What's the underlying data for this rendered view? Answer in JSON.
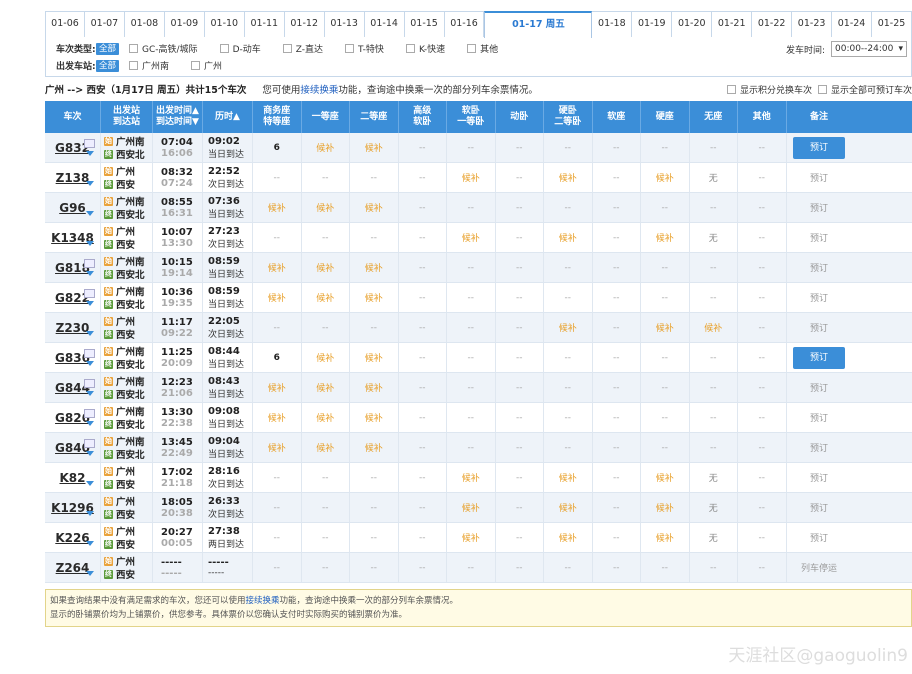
{
  "dates": [
    "01-06",
    "01-07",
    "01-08",
    "01-09",
    "01-10",
    "01-11",
    "01-12",
    "01-13",
    "01-14",
    "01-15",
    "01-16",
    "01-17 周五",
    "01-18",
    "01-19",
    "01-20",
    "01-21",
    "01-22",
    "01-23",
    "01-24",
    "01-25"
  ],
  "active_date_index": 11,
  "filters": {
    "type_label": "车次类型:",
    "all_label": "全部",
    "types": [
      "GC-高铁/城际",
      "D-动车",
      "Z-直达",
      "T-特快",
      "K-快速",
      "其他"
    ],
    "station_label": "出发车站:",
    "stations": [
      "广州南",
      "广州"
    ],
    "dep_time_label": "发车时间:",
    "dep_time_value": "00:00--24:00"
  },
  "summary": {
    "route": "广州 --> 西安（1月17日  周五）共计15个车次",
    "hint_pre": "您可使用",
    "hint_link": "接续换乘",
    "hint_post": "功能，查询途中换乘一次的部分列车余票情况。",
    "opt1": "显示积分兑换车次",
    "opt2": "显示全部可预订车次"
  },
  "headers": {
    "train": "车次",
    "station": [
      "出发站",
      "到达站"
    ],
    "time": [
      "出发时间▲",
      "到达时间▼"
    ],
    "duration": "历时▲",
    "seats": [
      "商务座\n特等座",
      "一等座",
      "二等座",
      "高级\n软卧",
      "软卧\n一等卧",
      "动卧",
      "硬卧\n二等卧",
      "软座",
      "硬座",
      "无座",
      "其他"
    ],
    "remark": "备注"
  },
  "rows": [
    {
      "no": "G832",
      "from": "广州南",
      "to": "西安北",
      "dep": "07:04",
      "arr": "16:06",
      "dur": "09:02",
      "day": "当日到达",
      "seats": [
        "6",
        "候补",
        "候补",
        "--",
        "--",
        "--",
        "--",
        "--",
        "--",
        "--",
        "--"
      ],
      "book": "预订",
      "book_active": true,
      "icon": true
    },
    {
      "no": "Z138",
      "from": "广州",
      "to": "西安",
      "dep": "08:32",
      "arr": "07:24",
      "dur": "22:52",
      "day": "次日到达",
      "seats": [
        "--",
        "--",
        "--",
        "--",
        "候补",
        "--",
        "候补",
        "--",
        "候补",
        "无",
        "--"
      ],
      "book": "预订",
      "book_active": false,
      "icon": false
    },
    {
      "no": "G96",
      "from": "广州南",
      "to": "西安北",
      "dep": "08:55",
      "arr": "16:31",
      "dur": "07:36",
      "day": "当日到达",
      "seats": [
        "候补",
        "候补",
        "候补",
        "--",
        "--",
        "--",
        "--",
        "--",
        "--",
        "--",
        "--"
      ],
      "book": "预订",
      "book_active": false,
      "icon": false
    },
    {
      "no": "K1348",
      "from": "广州",
      "to": "西安",
      "dep": "10:07",
      "arr": "13:30",
      "dur": "27:23",
      "day": "次日到达",
      "seats": [
        "--",
        "--",
        "--",
        "--",
        "候补",
        "--",
        "候补",
        "--",
        "候补",
        "无",
        "--"
      ],
      "book": "预订",
      "book_active": false,
      "icon": false
    },
    {
      "no": "G818",
      "from": "广州南",
      "to": "西安北",
      "dep": "10:15",
      "arr": "19:14",
      "dur": "08:59",
      "day": "当日到达",
      "seats": [
        "候补",
        "候补",
        "候补",
        "--",
        "--",
        "--",
        "--",
        "--",
        "--",
        "--",
        "--"
      ],
      "book": "预订",
      "book_active": false,
      "icon": true
    },
    {
      "no": "G822",
      "from": "广州南",
      "to": "西安北",
      "dep": "10:36",
      "arr": "19:35",
      "dur": "08:59",
      "day": "当日到达",
      "seats": [
        "候补",
        "候补",
        "候补",
        "--",
        "--",
        "--",
        "--",
        "--",
        "--",
        "--",
        "--"
      ],
      "book": "预订",
      "book_active": false,
      "icon": true
    },
    {
      "no": "Z230",
      "from": "广州",
      "to": "西安",
      "dep": "11:17",
      "arr": "09:22",
      "dur": "22:05",
      "day": "次日到达",
      "seats": [
        "--",
        "--",
        "--",
        "--",
        "--",
        "--",
        "候补",
        "--",
        "候补",
        "候补",
        "--"
      ],
      "book": "预订",
      "book_active": false,
      "icon": false
    },
    {
      "no": "G836",
      "from": "广州南",
      "to": "西安北",
      "dep": "11:25",
      "arr": "20:09",
      "dur": "08:44",
      "day": "当日到达",
      "seats": [
        "6",
        "候补",
        "候补",
        "--",
        "--",
        "--",
        "--",
        "--",
        "--",
        "--",
        "--"
      ],
      "book": "预订",
      "book_active": true,
      "icon": true
    },
    {
      "no": "G844",
      "from": "广州南",
      "to": "西安北",
      "dep": "12:23",
      "arr": "21:06",
      "dur": "08:43",
      "day": "当日到达",
      "seats": [
        "候补",
        "候补",
        "候补",
        "--",
        "--",
        "--",
        "--",
        "--",
        "--",
        "--",
        "--"
      ],
      "book": "预订",
      "book_active": false,
      "icon": true
    },
    {
      "no": "G826",
      "from": "广州南",
      "to": "西安北",
      "dep": "13:30",
      "arr": "22:38",
      "dur": "09:08",
      "day": "当日到达",
      "seats": [
        "候补",
        "候补",
        "候补",
        "--",
        "--",
        "--",
        "--",
        "--",
        "--",
        "--",
        "--"
      ],
      "book": "预订",
      "book_active": false,
      "icon": true
    },
    {
      "no": "G840",
      "from": "广州南",
      "to": "西安北",
      "dep": "13:45",
      "arr": "22:49",
      "dur": "09:04",
      "day": "当日到达",
      "seats": [
        "候补",
        "候补",
        "候补",
        "--",
        "--",
        "--",
        "--",
        "--",
        "--",
        "--",
        "--"
      ],
      "book": "预订",
      "book_active": false,
      "icon": true
    },
    {
      "no": "K82",
      "from": "广州",
      "to": "西安",
      "dep": "17:02",
      "arr": "21:18",
      "dur": "28:16",
      "day": "次日到达",
      "seats": [
        "--",
        "--",
        "--",
        "--",
        "候补",
        "--",
        "候补",
        "--",
        "候补",
        "无",
        "--"
      ],
      "book": "预订",
      "book_active": false,
      "icon": false
    },
    {
      "no": "K1296",
      "from": "广州",
      "to": "西安",
      "dep": "18:05",
      "arr": "20:38",
      "dur": "26:33",
      "day": "次日到达",
      "seats": [
        "--",
        "--",
        "--",
        "--",
        "候补",
        "--",
        "候补",
        "--",
        "候补",
        "无",
        "--"
      ],
      "book": "预订",
      "book_active": false,
      "icon": false
    },
    {
      "no": "K226",
      "from": "广州",
      "to": "西安",
      "dep": "20:27",
      "arr": "00:05",
      "dur": "27:38",
      "day": "两日到达",
      "seats": [
        "--",
        "--",
        "--",
        "--",
        "候补",
        "--",
        "候补",
        "--",
        "候补",
        "无",
        "--"
      ],
      "book": "预订",
      "book_active": false,
      "icon": false
    },
    {
      "no": "Z264",
      "from": "广州",
      "to": "西安",
      "dep": "-----",
      "arr": "-----",
      "dur": "-----",
      "day": "-----",
      "seats": [
        "--",
        "--",
        "--",
        "--",
        "--",
        "--",
        "--",
        "--",
        "--",
        "--",
        "--"
      ],
      "book": "列车停运",
      "book_active": false,
      "icon": false
    }
  ],
  "footnote": {
    "line1_pre": "如果查询结果中没有满足需求的车次，您还可以使用",
    "line1_link": "接续换乘",
    "line1_post": "功能，查询途中换乘一次的部分列车余票情况。",
    "line2": "显示的卧铺票价均为上铺票价，供您参考。具体票价以您确认支付时实际购买的铺别票价为准。"
  },
  "watermark": "天涯社区@gaoguolin9",
  "colors": {
    "accent": "#3b8ed8",
    "houbu": "#e8a02a"
  }
}
